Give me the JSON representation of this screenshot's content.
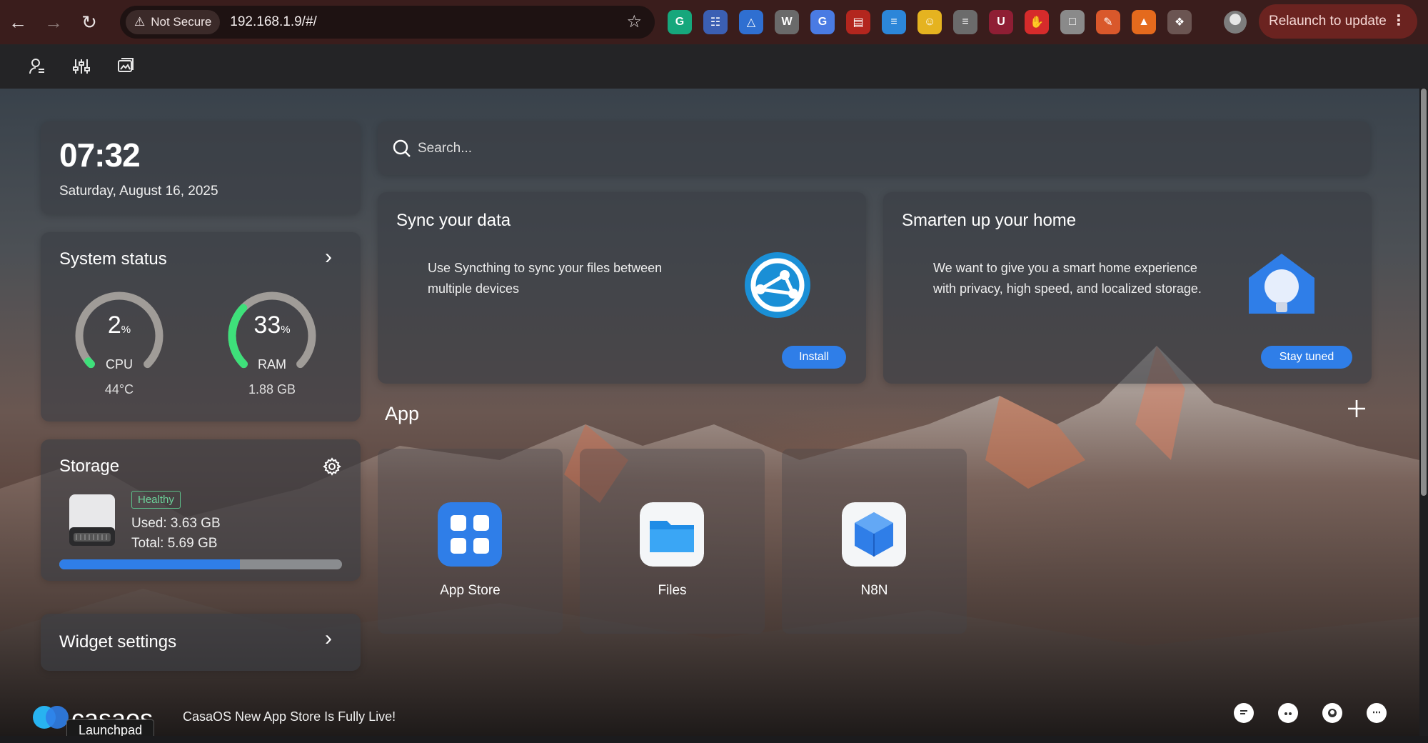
{
  "browser": {
    "security_label": "Not Secure",
    "url": "192.168.1.9/#/",
    "relaunch_label": "Relaunch to update",
    "extensions": [
      {
        "name": "grammarly-icon",
        "color": "#16a77c",
        "glyph": "G"
      },
      {
        "name": "translate-grid-icon",
        "color": "#3b5fb3",
        "glyph": "☷"
      },
      {
        "name": "triangle-icon",
        "color": "#2f6fd1",
        "glyph": "△"
      },
      {
        "name": "w-icon",
        "color": "#6a6a6a",
        "glyph": "W"
      },
      {
        "name": "google-translate-icon",
        "color": "#4a7be3",
        "glyph": "G"
      },
      {
        "name": "pdf-icon",
        "color": "#b3261e",
        "glyph": "▤"
      },
      {
        "name": "flow-icon",
        "color": "#2c86d9",
        "glyph": "≡"
      },
      {
        "name": "face-icon",
        "color": "#e5b320",
        "glyph": "☺"
      },
      {
        "name": "database-icon",
        "color": "#6b6b6b",
        "glyph": "≡"
      },
      {
        "name": "ublock-icon",
        "color": "#8f1e34",
        "glyph": "U"
      },
      {
        "name": "stop-hand-icon",
        "color": "#d62b2b",
        "glyph": "✋"
      },
      {
        "name": "doc-icon",
        "color": "#8a8a8a",
        "glyph": "□"
      },
      {
        "name": "pen-icon",
        "color": "#d9582b",
        "glyph": "✎"
      },
      {
        "name": "fox-icon",
        "color": "#e46a1d",
        "glyph": "▲"
      },
      {
        "name": "puzzle-icon",
        "color": "#6b5552",
        "glyph": "❖"
      }
    ]
  },
  "clock": {
    "time": "07:32",
    "date": "Saturday, August 16, 2025"
  },
  "system_status": {
    "title": "System status",
    "cpu": {
      "value": "2",
      "unit": "%",
      "label": "CPU",
      "sub": "44°C",
      "percent": 2
    },
    "ram": {
      "value": "33",
      "unit": "%",
      "label": "RAM",
      "sub": "1.88 GB",
      "percent": 33
    }
  },
  "storage": {
    "title": "Storage",
    "health": "Healthy",
    "used": "Used: 3.63 GB",
    "total": "Total: 5.69 GB",
    "used_fraction": 0.64
  },
  "widget_settings": {
    "title": "Widget settings"
  },
  "search": {
    "placeholder": "Search..."
  },
  "promos": [
    {
      "title": "Sync your data",
      "description": "Use Syncthing to sync your files between multiple devices",
      "button": "Install"
    },
    {
      "title": "Smarten up your home",
      "description": "We want to give you a smart home experience with privacy, high speed, and localized storage.",
      "button": "Stay tuned"
    }
  ],
  "apps": {
    "heading": "App",
    "items": [
      {
        "name": "App Store"
      },
      {
        "name": "Files"
      },
      {
        "name": "N8N"
      }
    ]
  },
  "footer": {
    "news": "CasaOS New App Store Is Fully Live!",
    "launchpad": "Launchpad"
  },
  "colors": {
    "accent": "#2f7ee8",
    "gauge_fill": "#3ee07a",
    "healthy": "#6dd39b"
  }
}
